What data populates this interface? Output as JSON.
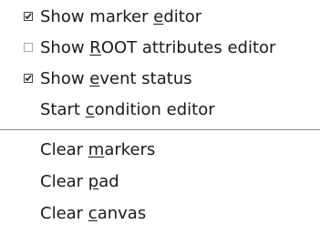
{
  "menu": {
    "items": [
      {
        "pre": "Show marker ",
        "u": "e",
        "post": "ditor",
        "checkbox": "checked"
      },
      {
        "pre": "Show ",
        "u": "R",
        "post": "OOT attributes editor",
        "checkbox": "unchecked"
      },
      {
        "pre": "Show ",
        "u": "e",
        "post": "vent status",
        "checkbox": "checked"
      },
      {
        "pre": "Start ",
        "u": "c",
        "post": "ondition editor",
        "checkbox": "none"
      },
      {
        "pre": "Clear ",
        "u": "m",
        "post": "arkers",
        "checkbox": "none"
      },
      {
        "pre": "Clear ",
        "u": "p",
        "post": "ad",
        "checkbox": "none"
      },
      {
        "pre": "Clear ",
        "u": "c",
        "post": "anvas",
        "checkbox": "none"
      }
    ]
  },
  "colors": {
    "background": "#ffffff",
    "text": "#1a1a1a",
    "separator": "#8a8a8a"
  }
}
